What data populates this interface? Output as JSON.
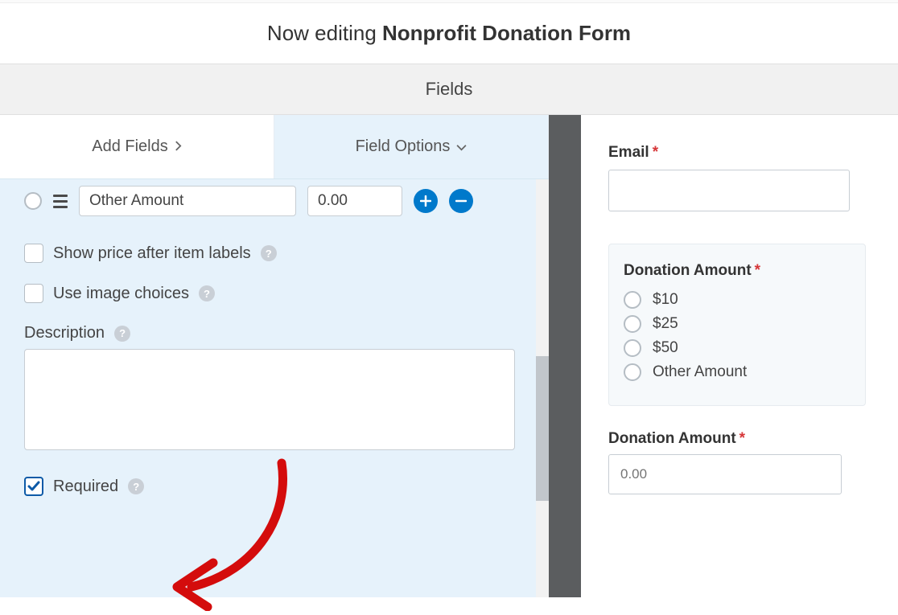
{
  "header": {
    "prefix": "Now editing ",
    "title": "Nonprofit Donation Form"
  },
  "fields_tab": {
    "label": "Fields"
  },
  "subtabs": {
    "add_fields": "Add Fields",
    "field_options": "Field Options"
  },
  "item_row": {
    "label_value": "Other Amount",
    "price_value": "0.00"
  },
  "options": {
    "show_price_after_labels": "Show price after item labels",
    "use_image_choices": "Use image choices",
    "description_label": "Description",
    "description_value": "",
    "required_label": "Required"
  },
  "preview": {
    "email_label": "Email",
    "donation_amount_label": "Donation Amount",
    "choices": [
      "$10",
      "$25",
      "$50",
      "Other Amount"
    ],
    "donation_amount2_label": "Donation Amount",
    "donation_amount2_placeholder": "0.00"
  },
  "icons": {
    "help": "?"
  }
}
